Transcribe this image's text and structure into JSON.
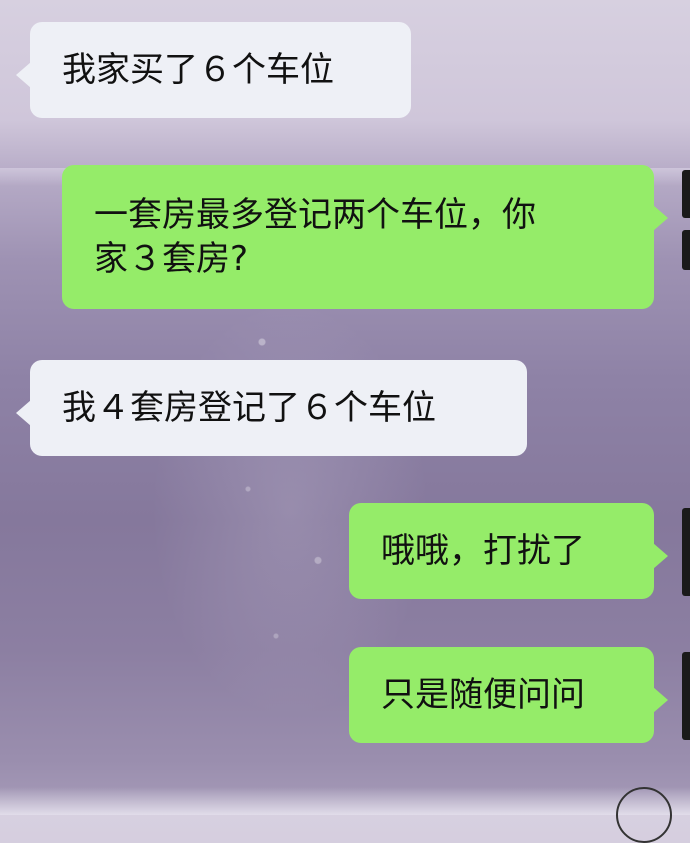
{
  "chat": {
    "messages": [
      {
        "from": "other",
        "text": "我家买了６个车位"
      },
      {
        "from": "self",
        "text": "一套房最多登记两个车位，你\n家３套房?"
      },
      {
        "from": "other",
        "text": "我４套房登记了６个车位"
      },
      {
        "from": "self",
        "text": "哦哦，打扰了"
      },
      {
        "from": "self",
        "text": "只是随便问问"
      }
    ]
  },
  "colors": {
    "incoming_bubble": "#eef0f6",
    "outgoing_bubble": "#95ec69"
  }
}
